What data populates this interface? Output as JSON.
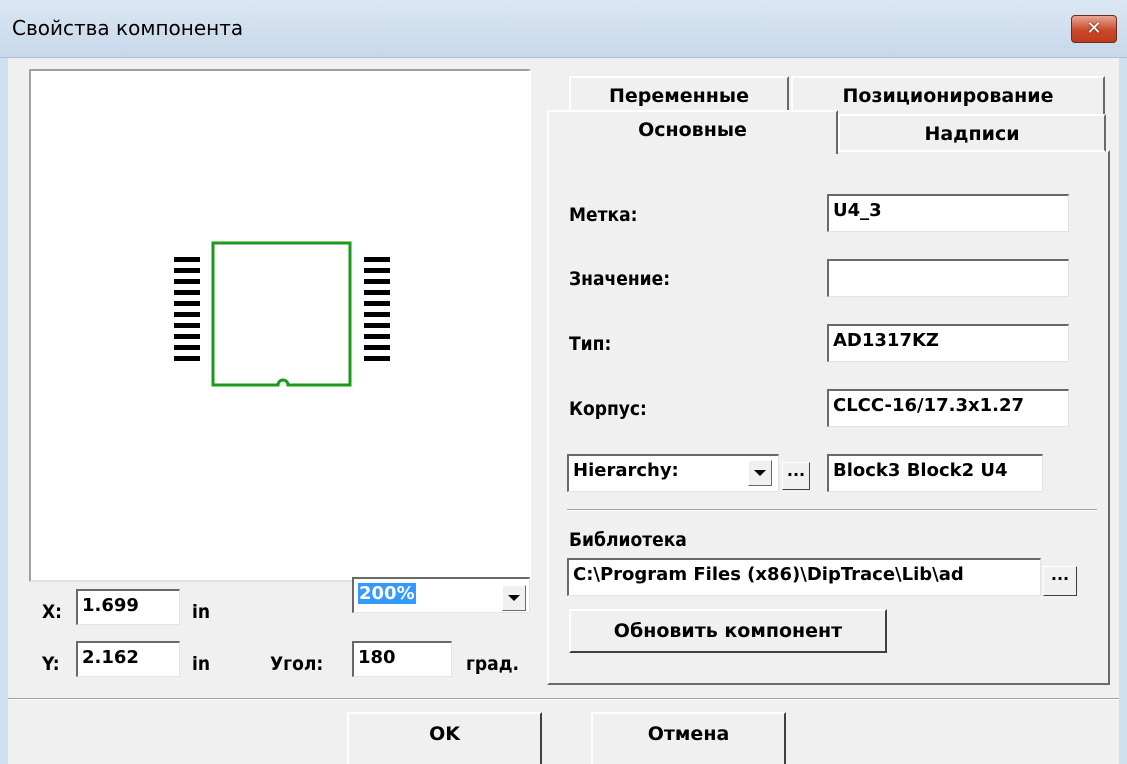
{
  "window": {
    "title": "Свойства компонента",
    "close_icon": "close-icon",
    "colors": {
      "close_button": "#c94a2c",
      "titlebar": "#c7d8ea",
      "outline": "#1a9a1a"
    }
  },
  "preview": {
    "x_label": "X:",
    "x_value": "1.699",
    "x_unit": "in",
    "y_label": "Y:",
    "y_value": "2.162",
    "y_unit": "in",
    "zoom_value": "200%",
    "angle_label": "Угол:",
    "angle_value": "180",
    "angle_unit": "град."
  },
  "tabs": {
    "back": [
      "Переменные",
      "Позиционирование"
    ],
    "front": [
      "Основные",
      "Надписи"
    ],
    "active": "Основные"
  },
  "general": {
    "label_caption": "Метка:",
    "label_value": "U4_3",
    "value_caption": "Значение:",
    "value_value": "",
    "type_caption": "Тип:",
    "type_value": "AD1317KZ",
    "package_caption": "Корпус:",
    "package_value": "CLCC-16/17.3x1.27",
    "hierarchy_select": "Hierarchy:",
    "hierarchy_browse": "...",
    "hierarchy_value": "Block3 Block2 U4",
    "library_caption": "Библиотека",
    "library_path": "C:\\Program Files (x86)\\DipTrace\\Lib\\ad",
    "library_browse": "...",
    "update_button": "Обновить компонент"
  },
  "footer": {
    "ok_label": "OK",
    "cancel_label": "Отмена"
  }
}
